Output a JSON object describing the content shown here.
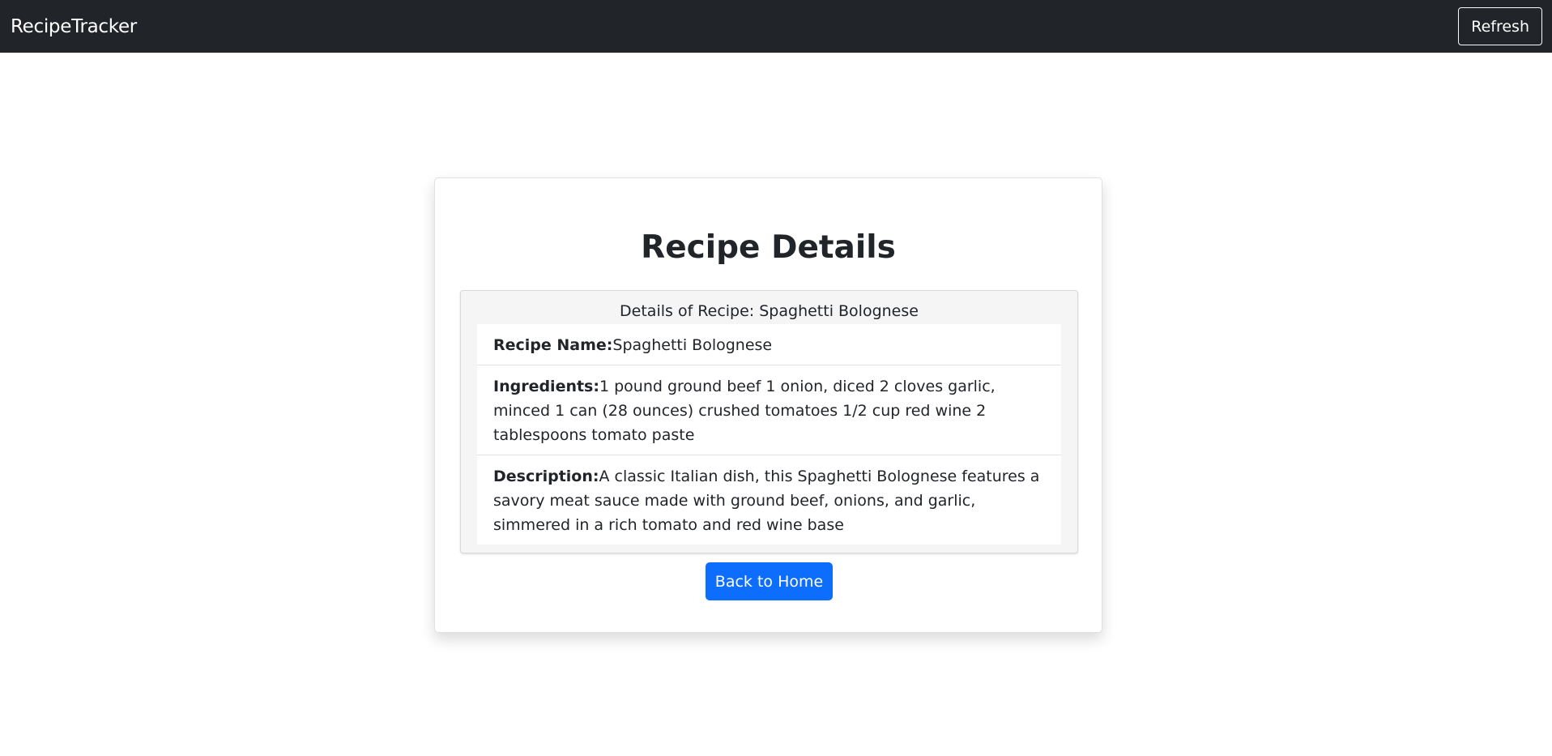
{
  "navbar": {
    "brand": "RecipeTracker",
    "refresh_label": "Refresh"
  },
  "page": {
    "title": "Recipe Details"
  },
  "details": {
    "header": "Details of Recipe: Spaghetti Bolognese",
    "name_label": "Recipe Name:",
    "name_value": "Spaghetti Bolognese",
    "ingredients_label": "Ingredients:",
    "ingredients_value": "1 pound ground beef 1 onion, diced 2 cloves garlic, minced 1 can (28 ounces) crushed tomatoes 1/2 cup red wine 2 tablespoons tomato paste",
    "description_label": "Description:",
    "description_value": "A classic Italian dish, this Spaghetti Bolognese features a savory meat sauce made with ground beef, onions, and garlic, simmered in a rich tomato and red wine base"
  },
  "actions": {
    "back_label": "Back to Home"
  },
  "colors": {
    "navbar_bg": "#212529",
    "primary": "#0d6efd"
  }
}
